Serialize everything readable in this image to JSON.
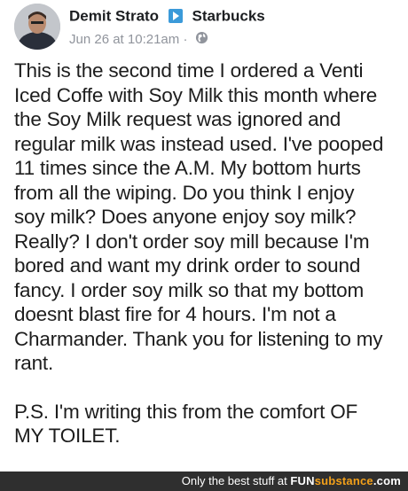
{
  "post": {
    "author": "Demit Strato",
    "page": "Starbucks",
    "timestamp": "Jun 26 at 10:21am",
    "separator": "·",
    "privacy_icon": "globe-icon",
    "lines": [
      "This is the second time I ordered a Venti",
      "Iced Coffe with Soy Milk this month where",
      "the Soy Milk request was ignored and",
      "regular milk was instead used.  I've pooped",
      "11 times since the A.M.  My bottom hurts",
      "from all the wiping.  Do you think I enjoy",
      "soy milk?  Does anyone enjoy soy milk?",
      "Really?  I don't order soy mill because I'm",
      "bored and want my drink order to sound",
      "fancy.  I order soy milk so that my bottom",
      "doesnt blast fire for 4 hours.  I'm not a",
      "Charmander.  Thank you for listening to my",
      "rant."
    ],
    "ps_lines": [
      "P.S.  I'm writing this from the comfort OF",
      "MY TOILET."
    ]
  },
  "watermark": {
    "tagline": "Only the best stuff at",
    "brand_fun": "FUN",
    "brand_sub": "substance",
    "brand_tld": ".com"
  },
  "colors": {
    "text": "#1d1d1d",
    "meta": "#90949c",
    "arrow": "#3b9ad9",
    "footer_bg": "#2f2f2f",
    "brand_accent": "#f2a01a"
  }
}
